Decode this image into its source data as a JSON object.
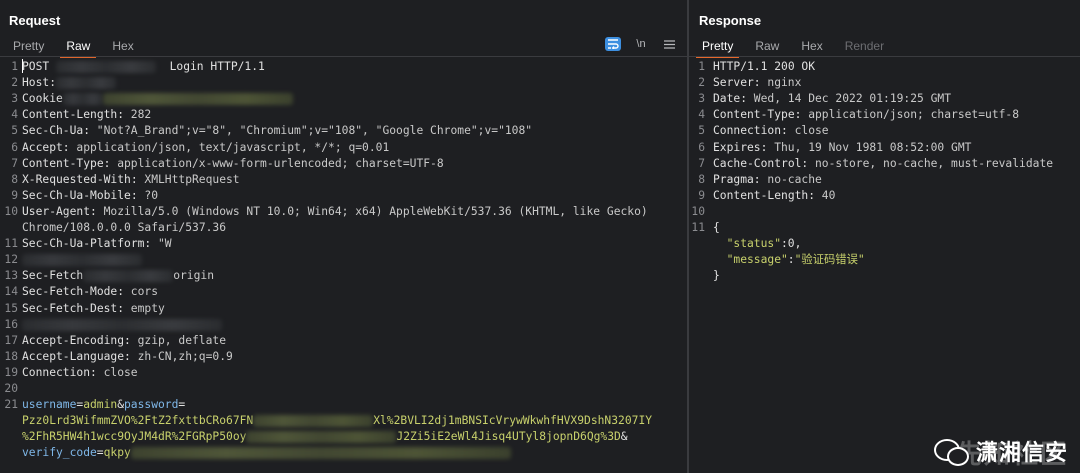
{
  "request": {
    "title": "Request",
    "tabs": [
      "Pretty",
      "Raw",
      "Hex"
    ],
    "active_tab": "Raw",
    "toolbar": {
      "wrap_icon": "wrap-lines-icon",
      "newline_label": "\\n",
      "menu_icon": "hamburger-menu-icon"
    },
    "lines": [
      {
        "n": "1",
        "parts": [
          {
            "t": "POST ",
            "c": "k"
          },
          {
            "blur": true,
            "w": 100
          },
          {
            "t": "  Login HTTP/1.1",
            "c": "k"
          }
        ]
      },
      {
        "n": "2",
        "parts": [
          {
            "t": "Host:",
            "c": "k"
          },
          {
            "blur": true,
            "w": 60
          }
        ]
      },
      {
        "n": "3",
        "parts": [
          {
            "t": "Cookie",
            "c": "k"
          },
          {
            "blur": true,
            "w": 40
          },
          {
            "blur": true,
            "w": 190,
            "g": true
          }
        ]
      },
      {
        "n": "4",
        "parts": [
          {
            "t": "Content-Length: ",
            "c": "k"
          },
          {
            "t": "282",
            "c": "v"
          }
        ]
      },
      {
        "n": "5",
        "parts": [
          {
            "t": "Sec-Ch-Ua: ",
            "c": "k"
          },
          {
            "t": "\"Not?A_Brand\";v=\"8\", \"Chromium\";v=\"108\", \"Google Chrome\";v=\"108\"",
            "c": "v"
          }
        ]
      },
      {
        "n": "6",
        "parts": [
          {
            "t": "Accept: ",
            "c": "k"
          },
          {
            "t": "application/json, text/javascript, */*; q=0.01",
            "c": "v"
          }
        ]
      },
      {
        "n": "7",
        "parts": [
          {
            "t": "Content-Type: ",
            "c": "k"
          },
          {
            "t": "application/x-www-form-urlencoded; charset=UTF-8",
            "c": "v"
          }
        ]
      },
      {
        "n": "8",
        "parts": [
          {
            "t": "X-Requested-With: ",
            "c": "k"
          },
          {
            "t": "XMLHttpRequest",
            "c": "v"
          }
        ]
      },
      {
        "n": "9",
        "parts": [
          {
            "t": "Sec-Ch-Ua-Mobile: ",
            "c": "k"
          },
          {
            "t": "?0",
            "c": "v"
          }
        ]
      },
      {
        "n": "10",
        "parts": [
          {
            "t": "User-Agent: ",
            "c": "k"
          },
          {
            "t": "Mozilla/5.0 (Windows NT 10.0; Win64; x64) AppleWebKit/537.36 (KHTML, like Gecko)",
            "c": "v"
          }
        ]
      },
      {
        "n": "",
        "parts": [
          {
            "t": "Chrome/108.0.0.0 Safari/537.36",
            "c": "v"
          }
        ]
      },
      {
        "n": "11",
        "parts": [
          {
            "t": "Sec-Ch-Ua-Platform: ",
            "c": "k"
          },
          {
            "t": "\"W",
            "c": "v"
          }
        ]
      },
      {
        "n": "12",
        "parts": [
          {
            "blur": true,
            "w": 120
          }
        ]
      },
      {
        "n": "13",
        "parts": [
          {
            "t": "Sec-Fetch",
            "c": "k"
          },
          {
            "blur": true,
            "w": 90
          },
          {
            "t": "origin",
            "c": "v"
          }
        ]
      },
      {
        "n": "14",
        "parts": [
          {
            "t": "Sec-Fetch-Mode: ",
            "c": "k"
          },
          {
            "t": "cors",
            "c": "v"
          }
        ]
      },
      {
        "n": "15",
        "parts": [
          {
            "t": "Sec-Fetch-Dest: ",
            "c": "k"
          },
          {
            "t": "empty",
            "c": "v"
          }
        ]
      },
      {
        "n": "16",
        "parts": [
          {
            "blur": true,
            "w": 200
          }
        ]
      },
      {
        "n": "17",
        "parts": [
          {
            "t": "Accept-Encoding: ",
            "c": "k"
          },
          {
            "t": "gzip, deflate",
            "c": "v"
          }
        ]
      },
      {
        "n": "18",
        "parts": [
          {
            "t": "Accept-Language: ",
            "c": "k"
          },
          {
            "t": "zh-CN,zh;q=0.9",
            "c": "v"
          }
        ]
      },
      {
        "n": "19",
        "parts": [
          {
            "t": "Connection: ",
            "c": "k"
          },
          {
            "t": "close",
            "c": "v"
          }
        ]
      },
      {
        "n": "20",
        "parts": []
      },
      {
        "n": "21",
        "parts": [
          {
            "t": "username",
            "c": "blu"
          },
          {
            "t": "=",
            "c": "k"
          },
          {
            "t": "admin",
            "c": "grn"
          },
          {
            "t": "&",
            "c": "k"
          },
          {
            "t": "password",
            "c": "blu"
          },
          {
            "t": "=",
            "c": "k"
          }
        ]
      },
      {
        "n": "",
        "parts": [
          {
            "t": "Pzz0Lrd3WifmmZVO%2FtZ2fxttbCRo67FN",
            "c": "grn"
          },
          {
            "blur": true,
            "w": 120,
            "g": true
          },
          {
            "t": "Xl%2BVLI2dj1mBNSIcVrywWkwhfHVX9DshN3207IY",
            "c": "grn"
          }
        ]
      },
      {
        "n": "",
        "parts": [
          {
            "t": "%2FhR5HW4h1wcc9OyJM4dR%2FGRpP50oy",
            "c": "grn"
          },
          {
            "blur": true,
            "w": 150,
            "g": true
          },
          {
            "t": "J2Zi5iE2eWl4Jisq4UTyl8jopnD6Qg%3D",
            "c": "grn"
          },
          {
            "t": "&",
            "c": "k"
          }
        ]
      },
      {
        "n": "",
        "parts": [
          {
            "t": "verify_code",
            "c": "blu"
          },
          {
            "t": "=",
            "c": "k"
          },
          {
            "t": "qkpy",
            "c": "grn"
          },
          {
            "blur": true,
            "w": 380,
            "g": true
          }
        ]
      }
    ]
  },
  "response": {
    "title": "Response",
    "tabs": [
      "Pretty",
      "Raw",
      "Hex",
      "Render"
    ],
    "active_tab": "Pretty",
    "disabled_tab": "Render",
    "lines": [
      {
        "n": "1",
        "parts": [
          {
            "t": "HTTP/1.1 200 OK",
            "c": "k"
          }
        ]
      },
      {
        "n": "2",
        "parts": [
          {
            "t": "Server: ",
            "c": "k"
          },
          {
            "t": "nginx",
            "c": "v"
          }
        ]
      },
      {
        "n": "3",
        "parts": [
          {
            "t": "Date: ",
            "c": "k"
          },
          {
            "t": "Wed, 14 Dec 2022 01:19:25 GMT",
            "c": "v"
          }
        ]
      },
      {
        "n": "4",
        "parts": [
          {
            "t": "Content-Type: ",
            "c": "k"
          },
          {
            "t": "application/json; charset=utf-8",
            "c": "v"
          }
        ]
      },
      {
        "n": "5",
        "parts": [
          {
            "t": "Connection: ",
            "c": "k"
          },
          {
            "t": "close",
            "c": "v"
          }
        ]
      },
      {
        "n": "6",
        "parts": [
          {
            "t": "Expires: ",
            "c": "k"
          },
          {
            "t": "Thu, 19 Nov 1981 08:52:00 GMT",
            "c": "v"
          }
        ]
      },
      {
        "n": "7",
        "parts": [
          {
            "t": "Cache-Control: ",
            "c": "k"
          },
          {
            "t": "no-store, no-cache, must-revalidate",
            "c": "v"
          }
        ]
      },
      {
        "n": "8",
        "parts": [
          {
            "t": "Pragma: ",
            "c": "k"
          },
          {
            "t": "no-cache",
            "c": "v"
          }
        ]
      },
      {
        "n": "9",
        "parts": [
          {
            "t": "Content-Length: ",
            "c": "k"
          },
          {
            "t": "40",
            "c": "v"
          }
        ]
      },
      {
        "n": "10",
        "parts": []
      },
      {
        "n": "11",
        "parts": [
          {
            "t": "{",
            "c": "k"
          }
        ]
      },
      {
        "n": "",
        "parts": [
          {
            "t": "  \"status\"",
            "c": "str"
          },
          {
            "t": ":0,",
            "c": "k"
          }
        ]
      },
      {
        "n": "",
        "parts": [
          {
            "t": "  \"message\"",
            "c": "str"
          },
          {
            "t": ":",
            "c": "k"
          },
          {
            "t": "\"验证码错误\"",
            "c": "str"
          }
        ]
      },
      {
        "n": "",
        "parts": [
          {
            "t": "}",
            "c": "k"
          }
        ]
      }
    ]
  },
  "watermark": {
    "primary": "潇湘信安",
    "secondary": "先知社区"
  },
  "colors": {
    "background": "#1e1f22",
    "accent_tab": "#e8682b",
    "toolbar_active": "#3d8fe0",
    "param_name": "#7fb7e8",
    "param_value": "#c8d16c"
  }
}
